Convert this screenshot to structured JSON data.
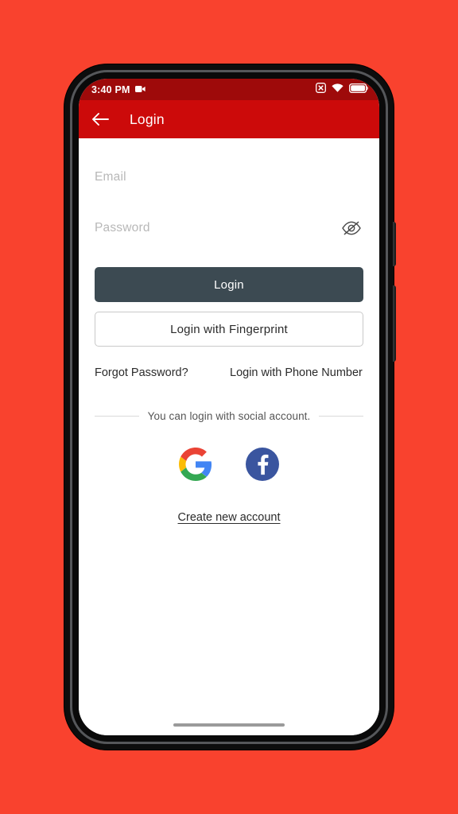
{
  "theme": {
    "page_background": "#F9422E",
    "status_bar_color": "#9E0A0A",
    "app_bar_color": "#CC0A0A",
    "primary_button_color": "#3C4A52",
    "placeholder_color": "#B8B8B8",
    "google_red": "#EA4335",
    "google_yellow": "#FBBC05",
    "google_green": "#34A853",
    "google_blue": "#4285F4",
    "facebook_blue": "#3A559F"
  },
  "status_bar": {
    "time": "3:40 PM",
    "icons": {
      "recording": "video-camera-icon",
      "silent": "ringer-off-icon",
      "wifi": "wifi-icon",
      "battery": "battery-full-icon"
    }
  },
  "app_bar": {
    "back_icon": "back-arrow-icon",
    "title": "Login"
  },
  "form": {
    "email": {
      "placeholder": "Email",
      "value": ""
    },
    "password": {
      "placeholder": "Password",
      "value": "",
      "toggle_icon": "eye-off-icon"
    }
  },
  "buttons": {
    "login": "Login",
    "fingerprint": "Login with Fingerprint"
  },
  "links": {
    "forgot_password": "Forgot Password?",
    "phone_login": "Login with Phone Number",
    "create_account": "Create new account"
  },
  "social": {
    "divider_text": "You can login with social account.",
    "google_label": "google-logo",
    "facebook_label": "facebook-logo"
  }
}
